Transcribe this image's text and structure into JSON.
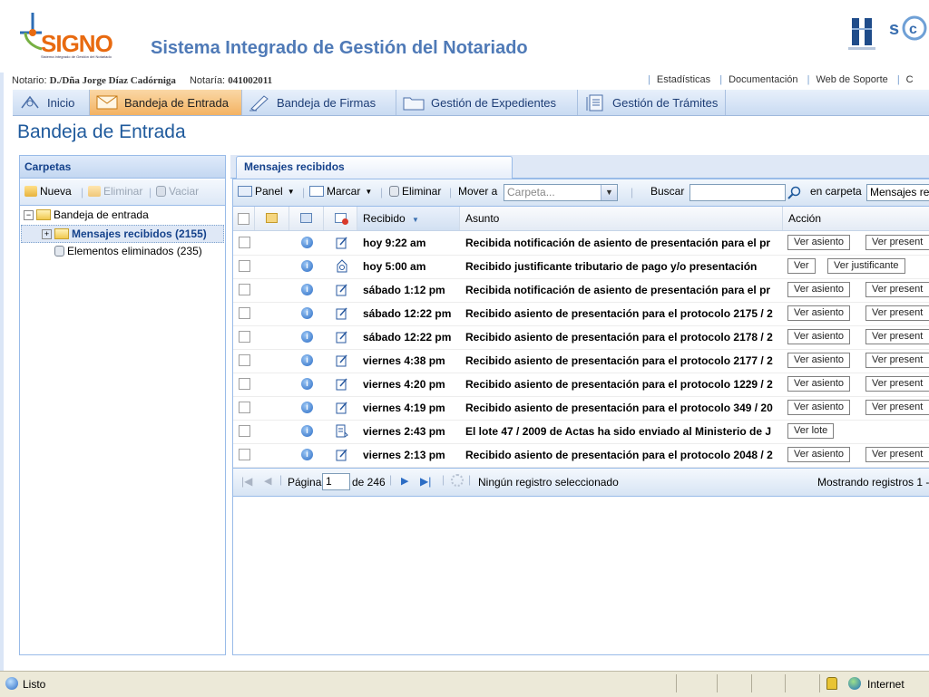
{
  "header": {
    "logo_text": "SIGNO",
    "logo_subtitle": "Sistema Integrado de Gestión del Notariado",
    "title": "Sistema Integrado de Gestión del Notariado",
    "notario_label": "Notario:",
    "notario_value": "D./Dña Jorge Díaz Cadórniga",
    "notaria_label": "Notaría:",
    "notaria_value": "041002011",
    "links": [
      "Estadísticas",
      "Documentación",
      "Web de Soporte",
      "C"
    ]
  },
  "menu": [
    {
      "label": "Inicio",
      "icon": "home-icon",
      "active": false
    },
    {
      "label": "Bandeja de Entrada",
      "icon": "envelope-icon",
      "active": true
    },
    {
      "label": "Bandeja de Firmas",
      "icon": "pen-icon",
      "active": false
    },
    {
      "label": "Gestión de Expedientes",
      "icon": "folder-icon",
      "active": false
    },
    {
      "label": "Gestión de Trámites",
      "icon": "document-icon",
      "active": false
    }
  ],
  "page_title": "Bandeja de Entrada",
  "folders": {
    "title": "Carpetas",
    "toolbar": {
      "new": "Nueva",
      "delete": "Eliminar",
      "empty": "Vaciar"
    },
    "tree": {
      "root": "Bandeja de entrada",
      "received": "Mensajes recibidos (2155)",
      "deleted": "Elementos eliminados (235)"
    }
  },
  "messages": {
    "tab": "Mensajes recibidos",
    "toolbar": {
      "panel": "Panel",
      "mark": "Marcar",
      "delete": "Eliminar",
      "move_to": "Mover a",
      "folder_placeholder": "Carpeta...",
      "search": "Buscar",
      "search_value": "",
      "in_folder": "en carpeta",
      "folder_value": "Mensajes re"
    },
    "columns": {
      "received": "Recibido",
      "subject": "Asunto",
      "action": "Acción"
    },
    "rows": [
      {
        "received": "hoy 9:22 am",
        "subject": "Recibida notificación de asiento de presentación para el pr",
        "buttons": [
          "Ver asiento",
          "Ver present"
        ],
        "type": "edit"
      },
      {
        "received": "hoy 5:00 am",
        "subject": "Recibido justificante tributario de pago y/o presentación",
        "buttons": [
          "Ver",
          "Ver justificante"
        ],
        "type": "receipt"
      },
      {
        "received": "sábado 1:12 pm",
        "subject": "Recibida notificación de asiento de presentación para el pr",
        "buttons": [
          "Ver asiento",
          "Ver present"
        ],
        "type": "edit"
      },
      {
        "received": "sábado 12:22 pm",
        "subject": "Recibido asiento de presentación para el protocolo 2175 / 2",
        "buttons": [
          "Ver asiento",
          "Ver present"
        ],
        "type": "edit"
      },
      {
        "received": "sábado 12:22 pm",
        "subject": "Recibido asiento de presentación para el protocolo 2178 / 2",
        "buttons": [
          "Ver asiento",
          "Ver present"
        ],
        "type": "edit"
      },
      {
        "received": "viernes 4:38 pm",
        "subject": "Recibido asiento de presentación para el protocolo 2177 / 2",
        "buttons": [
          "Ver asiento",
          "Ver present"
        ],
        "type": "edit"
      },
      {
        "received": "viernes 4:20 pm",
        "subject": "Recibido asiento de presentación para el protocolo 1229 / 2",
        "buttons": [
          "Ver asiento",
          "Ver present"
        ],
        "type": "edit"
      },
      {
        "received": "viernes 4:19 pm",
        "subject": "Recibido asiento de presentación para el protocolo 349 / 20",
        "buttons": [
          "Ver asiento",
          "Ver present"
        ],
        "type": "edit"
      },
      {
        "received": "viernes 2:43 pm",
        "subject": "El lote 47 / 2009 de Actas ha sido enviado al Ministerio de J",
        "buttons": [
          "Ver lote"
        ],
        "type": "batch"
      },
      {
        "received": "viernes 2:13 pm",
        "subject": "Recibido asiento de presentación para el protocolo 2048 / 2",
        "buttons": [
          "Ver asiento",
          "Ver present"
        ],
        "type": "edit"
      }
    ],
    "pager": {
      "page_label": "Página",
      "page_value": "1",
      "of_label": "de 246",
      "selection": "Ningún registro seleccionado",
      "showing": "Mostrando registros 1 -"
    }
  },
  "statusbar": {
    "status": "Listo",
    "zone": "Internet"
  },
  "colors": {
    "accent": "#f3b262",
    "brand_blue": "#4f7ab7",
    "panel_border": "#99bbe8"
  }
}
